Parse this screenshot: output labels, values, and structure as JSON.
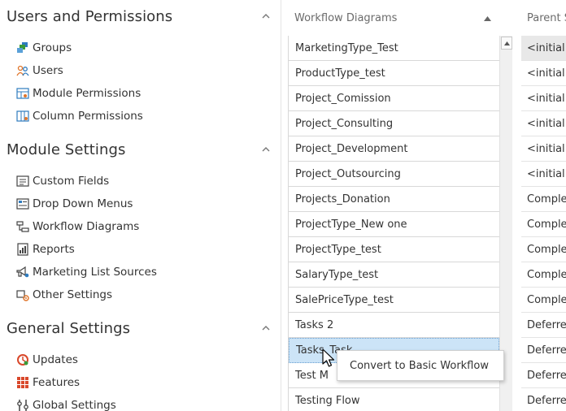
{
  "sidebar": {
    "sections": [
      {
        "title": "Users and Permissions",
        "items": [
          {
            "label": "Groups",
            "icon": "groups-icon"
          },
          {
            "label": "Users",
            "icon": "users-icon"
          },
          {
            "label": "Module Permissions",
            "icon": "module-permissions-icon"
          },
          {
            "label": "Column Permissions",
            "icon": "column-permissions-icon"
          }
        ]
      },
      {
        "title": "Module Settings",
        "items": [
          {
            "label": "Custom Fields",
            "icon": "custom-fields-icon"
          },
          {
            "label": "Drop Down Menus",
            "icon": "drop-down-menus-icon"
          },
          {
            "label": "Workflow Diagrams",
            "icon": "workflow-diagrams-icon"
          },
          {
            "label": "Reports",
            "icon": "reports-icon"
          },
          {
            "label": "Marketing List Sources",
            "icon": "marketing-list-sources-icon"
          },
          {
            "label": "Other Settings",
            "icon": "other-settings-icon"
          }
        ]
      },
      {
        "title": "General Settings",
        "items": [
          {
            "label": "Updates",
            "icon": "updates-icon"
          },
          {
            "label": "Features",
            "icon": "features-icon"
          },
          {
            "label": "Global Settings",
            "icon": "global-settings-icon"
          }
        ]
      }
    ]
  },
  "grid": {
    "columns": {
      "workflow": "Workflow Diagrams",
      "parent": "Parent S"
    },
    "rows": [
      {
        "name": "MarketingType_Test",
        "parent": "<initial>"
      },
      {
        "name": "ProductType_test",
        "parent": "<initial>"
      },
      {
        "name": "Project_Comission",
        "parent": "<initial>"
      },
      {
        "name": "Project_Consulting",
        "parent": "<initial>"
      },
      {
        "name": "Project_Development",
        "parent": "<initial>"
      },
      {
        "name": "Project_Outsourcing",
        "parent": "<initial>"
      },
      {
        "name": "Projects_Donation",
        "parent": "Comple"
      },
      {
        "name": "ProjectType_New one",
        "parent": "Comple"
      },
      {
        "name": "ProjectType_test",
        "parent": "Comple"
      },
      {
        "name": "SalaryType_test",
        "parent": "Comple"
      },
      {
        "name": "SalePriceType_test",
        "parent": "Comple"
      },
      {
        "name": "Tasks 2",
        "parent": "Deferred"
      },
      {
        "name": "Tasks_Task",
        "parent": "Deferred"
      },
      {
        "name": "Test M",
        "parent": "Deferred"
      },
      {
        "name": "Testing Flow",
        "parent": "Deferred"
      }
    ],
    "selected_index": 12
  },
  "context_menu": {
    "items": [
      "Convert to Basic Workflow"
    ]
  },
  "colors": {
    "selected_row": "#cce4f7",
    "icon_blue": "#2e7bbf",
    "icon_green": "#3a9a3a",
    "icon_orange": "#e0752a"
  }
}
